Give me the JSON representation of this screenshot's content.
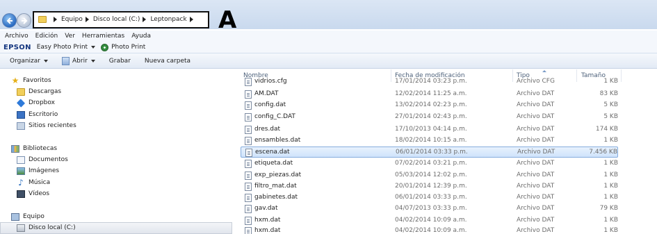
{
  "address": {
    "crumbs": [
      "Equipo",
      "Disco local (C:)",
      "Leptonpack"
    ],
    "annotation": "A"
  },
  "menu": [
    "Archivo",
    "Edición",
    "Ver",
    "Herramientas",
    "Ayuda"
  ],
  "epson": {
    "logo": "EPSON",
    "app": "Easy Photo Print",
    "photo_print": "Photo Print"
  },
  "commands": {
    "organize": "Organizar",
    "open": "Abrir",
    "burn": "Grabar",
    "new_folder": "Nueva carpeta"
  },
  "nav": {
    "favorites": "Favoritos",
    "downloads": "Descargas",
    "dropbox": "Dropbox",
    "desktop": "Escritorio",
    "recent": "Sitios recientes",
    "libraries": "Bibliotecas",
    "documents": "Documentos",
    "images": "Imágenes",
    "music": "Música",
    "videos": "Vídeos",
    "computer": "Equipo",
    "local_disk": "Disco local (C:)"
  },
  "columns": {
    "name": "Nombre",
    "date": "Fecha de modificación",
    "type": "Tipo",
    "size": "Tamaño"
  },
  "files": [
    {
      "name": "vidrios.cfg",
      "date": "17/01/2014 03:23 p.m.",
      "type": "Archivo CFG",
      "size": "1 KB"
    },
    {
      "name": "AM.DAT",
      "date": "12/02/2014 11:25 a.m.",
      "type": "Archivo DAT",
      "size": "83 KB"
    },
    {
      "name": "config.dat",
      "date": "13/02/2014 02:23 p.m.",
      "type": "Archivo DAT",
      "size": "5 KB"
    },
    {
      "name": "config_C.DAT",
      "date": "27/01/2014 02:43 p.m.",
      "type": "Archivo DAT",
      "size": "5 KB"
    },
    {
      "name": "dres.dat",
      "date": "17/10/2013 04:14 p.m.",
      "type": "Archivo DAT",
      "size": "174 KB"
    },
    {
      "name": "ensambles.dat",
      "date": "18/02/2014 10:15 a.m.",
      "type": "Archivo DAT",
      "size": "1 KB"
    },
    {
      "name": "escena.dat",
      "date": "06/01/2014 03:33 p.m.",
      "type": "Archivo DAT",
      "size": "7.456 KB"
    },
    {
      "name": "etiqueta.dat",
      "date": "07/02/2014 03:21 p.m.",
      "type": "Archivo DAT",
      "size": "1 KB"
    },
    {
      "name": "exp_piezas.dat",
      "date": "05/03/2014 12:02 p.m.",
      "type": "Archivo DAT",
      "size": "1 KB"
    },
    {
      "name": "filtro_mat.dat",
      "date": "20/01/2014 12:39 p.m.",
      "type": "Archivo DAT",
      "size": "1 KB"
    },
    {
      "name": "gabinetes.dat",
      "date": "06/01/2014 03:33 p.m.",
      "type": "Archivo DAT",
      "size": "1 KB"
    },
    {
      "name": "gav.dat",
      "date": "04/07/2013 03:33 p.m.",
      "type": "Archivo DAT",
      "size": "79 KB"
    },
    {
      "name": "hxm.dat",
      "date": "04/02/2014 10:09 a.m.",
      "type": "Archivo DAT",
      "size": "1 KB"
    },
    {
      "name": "hxm.dat",
      "date": "04/02/2014 10:09 a.m.",
      "type": "Archivo DAT",
      "size": "1 KB"
    }
  ],
  "selected_file": "escena.dat",
  "colors": {
    "epson_blue": "#13357f",
    "selection_border": "#84acdd",
    "header_text": "#4c607a"
  }
}
